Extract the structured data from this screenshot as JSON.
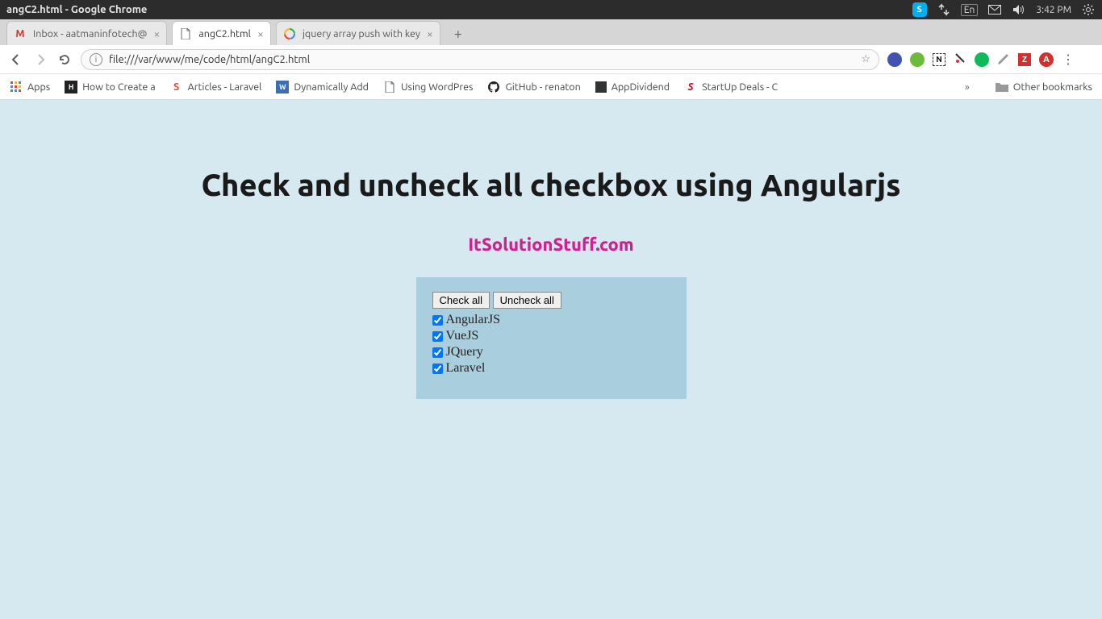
{
  "panel": {
    "window_title": "angC2.html - Google Chrome",
    "tray": {
      "lang": "En",
      "time": "3:42 PM"
    }
  },
  "tabs": [
    {
      "title": "Inbox - aatmaninfotech@",
      "active": false
    },
    {
      "title": "angC2.html",
      "active": true
    },
    {
      "title": "jquery array push with key",
      "active": false
    }
  ],
  "omnibox": {
    "scheme_label": "i",
    "url": "file:///var/www/me/code/html/angC2.html"
  },
  "bookmarks": {
    "apps": "Apps",
    "items": [
      "How to Create a",
      "Articles - Laravel",
      "Dynamically Add",
      "Using WordPres",
      "GitHub - renaton",
      "AppDividend",
      "StartUp Deals - C"
    ],
    "overflow": "»",
    "other": "Other bookmarks"
  },
  "page": {
    "title": "Check and uncheck all checkbox using Angularjs",
    "subtitle": "ItSolutionStuff.com",
    "check_all_label": "Check all",
    "uncheck_all_label": "Uncheck all",
    "items": [
      {
        "label": "AngularJS",
        "checked": true
      },
      {
        "label": "VueJS",
        "checked": true
      },
      {
        "label": "JQuery",
        "checked": true
      },
      {
        "label": "Laravel",
        "checked": true
      }
    ]
  }
}
